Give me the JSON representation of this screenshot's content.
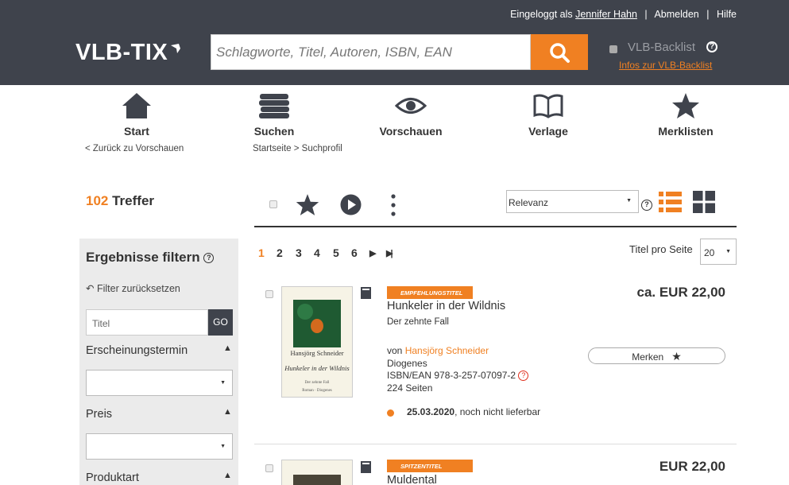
{
  "header": {
    "logged_in_prefix": "Eingeloggt als",
    "user_name": "Jennifer Hahn",
    "logout": "Abmelden",
    "help": "Hilfe",
    "logo_text": "VLB-TIX",
    "search_placeholder": "Schlagworte, Titel, Autoren, ISBN, EAN",
    "backlist_label": "VLB-Backlist",
    "backlist_info": "Infos zur VLB-Backlist"
  },
  "nav": {
    "items": [
      {
        "label": "Start",
        "icon": "home-icon"
      },
      {
        "label": "Suchen",
        "icon": "books-icon"
      },
      {
        "label": "Vorschauen",
        "icon": "eye-icon"
      },
      {
        "label": "Verlage",
        "icon": "open-book-icon"
      },
      {
        "label": "Merklisten",
        "icon": "star-icon"
      }
    ],
    "back_link": "< Zurück zu Vorschauen",
    "breadcrumb": "Startseite > Suchprofil"
  },
  "results": {
    "count": "102",
    "label": "Treffer",
    "sort_value": "Relevanz",
    "per_page_label": "Titel pro Seite",
    "per_page_value": "20",
    "pages": [
      "1",
      "2",
      "3",
      "4",
      "5",
      "6"
    ]
  },
  "filter": {
    "title": "Ergebnisse filtern",
    "reset": "Filter zurücksetzen",
    "title_placeholder": "Titel",
    "go": "GO",
    "sections": [
      "Erscheinungstermin",
      "Preis",
      "Produktart"
    ]
  },
  "items": [
    {
      "badge": "EMPFEHLUNGSTITEL",
      "title": "Hunkeler in der Wildnis",
      "subtitle": "Der zehnte Fall",
      "by": "von",
      "author": "Hansjörg Schneider",
      "publisher": "Diogenes",
      "isbn": "ISBN/EAN 978-3-257-07097-2",
      "pages": "224 Seiten",
      "price": "ca. EUR 22,00",
      "merken": "Merken",
      "date": "25.03.2020",
      "availability": ", noch nicht lieferbar",
      "cover_author": "Hansjörg Schneider",
      "cover_title": "Hunkeler in der Wildnis",
      "cover_sub": "Der zehnte Fall",
      "cover_pub": "Roman · Diogenes"
    },
    {
      "badge": "SPITZENTITEL",
      "title": "Muldental",
      "price": "EUR 22,00"
    }
  ],
  "colors": {
    "accent": "#f08022",
    "header_bg": "#3f434c",
    "filter_bg": "#ebebeb"
  }
}
